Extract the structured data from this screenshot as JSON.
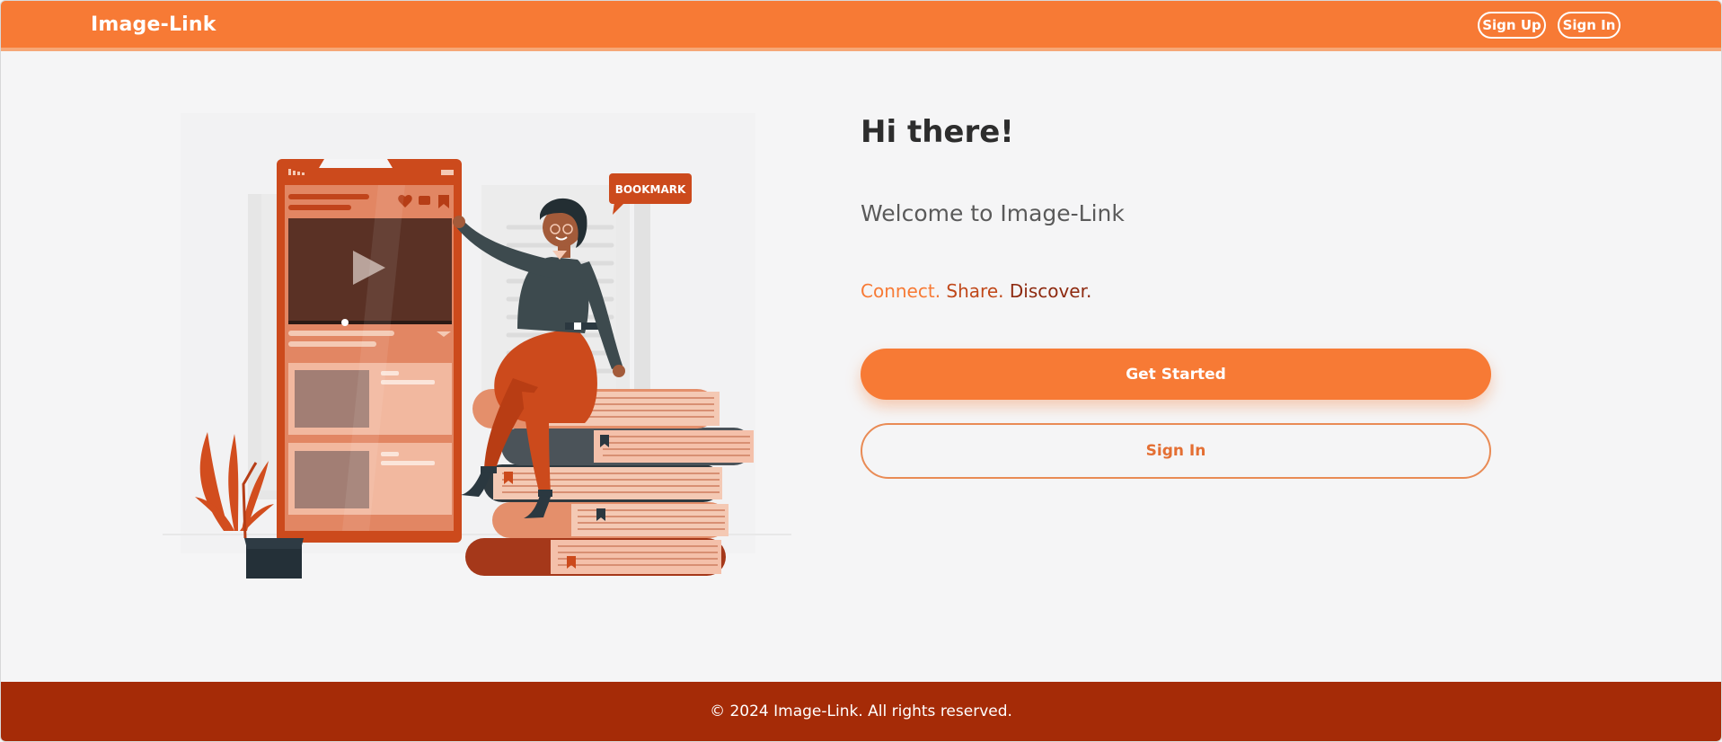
{
  "header": {
    "logo": "Image-Link",
    "sign_up_label": "Sign Up",
    "sign_in_label": "Sign In"
  },
  "hero": {
    "greeting": "Hi there!",
    "welcome": "Welcome to Image-Link",
    "tagline": {
      "part1": "Connect.",
      "part2": "Share.",
      "part3": "Discover."
    },
    "get_started_label": "Get Started",
    "sign_in_label": "Sign In"
  },
  "illustration": {
    "bookmark_label": "BOOKMARK",
    "icons": [
      "heart-icon",
      "comment-icon",
      "bookmark-icon",
      "play-icon"
    ]
  },
  "footer": {
    "copyright": "© 2024 Image-Link. All rights reserved."
  },
  "colors": {
    "accent": "#f77a35",
    "dark_accent": "#a52b07",
    "background": "#f5f5f6"
  }
}
